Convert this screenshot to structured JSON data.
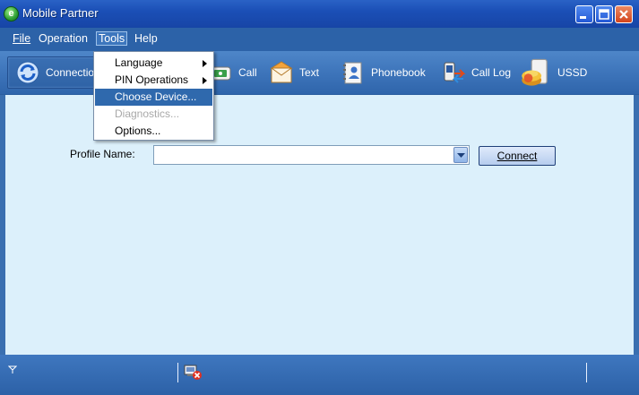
{
  "window": {
    "title": "Mobile Partner",
    "app_icon": "mobile-partner-logo-icon",
    "app_icon_glyph": "e"
  },
  "menubar": {
    "file": "File",
    "operation": "Operation",
    "tools": "Tools",
    "help": "Help"
  },
  "tools_menu": {
    "items": [
      {
        "label": "Language",
        "submenu": true,
        "state": "normal"
      },
      {
        "label": "PIN Operations",
        "submenu": true,
        "state": "normal"
      },
      {
        "label": "Choose Device...",
        "submenu": false,
        "state": "selected"
      },
      {
        "label": "Diagnostics...",
        "submenu": false,
        "state": "disabled"
      },
      {
        "label": "Options...",
        "submenu": false,
        "state": "normal"
      }
    ]
  },
  "toolbar": {
    "connection": "Connection",
    "call": "Call",
    "text": "Text",
    "phonebook": "Phonebook",
    "call_log": "Call Log",
    "ussd": "USSD"
  },
  "profile": {
    "label": "Profile Name:",
    "value": ""
  },
  "connect_label": "Connect",
  "colors": {
    "content_bg": "#dcf0fb",
    "bar_blue": "#2c62a8",
    "menu_highlight": "#2f69ad"
  }
}
